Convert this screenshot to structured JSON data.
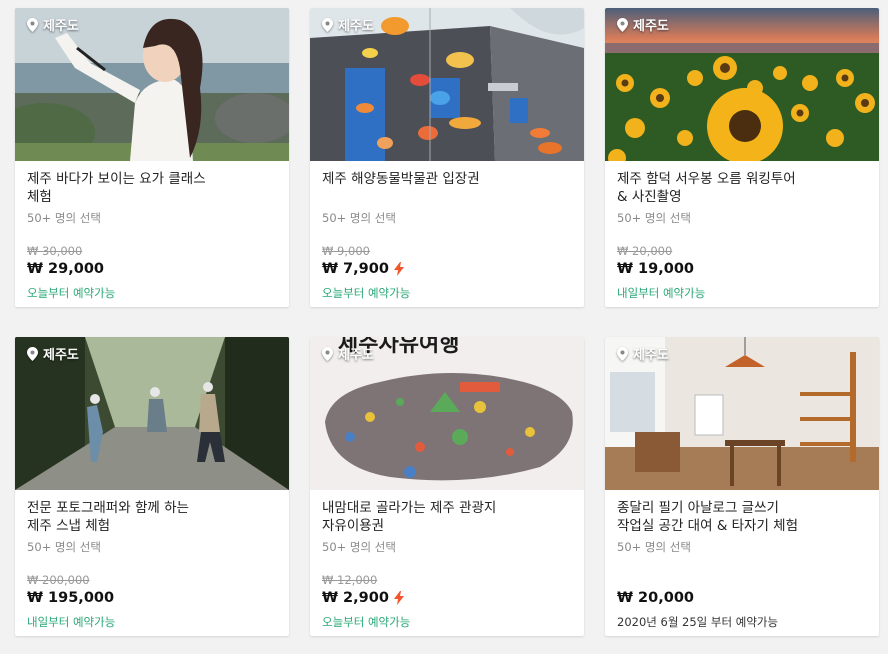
{
  "products": [
    {
      "location": "제주도",
      "title": "제주 바다가 보이는 요가 클래스\n체험",
      "picks": "50+ 명의 선택",
      "original_price": "₩ 30,000",
      "price": "₩ 29,000",
      "instant": false,
      "availability": "오늘부터 예약가능",
      "availability_color": "#2aa876"
    },
    {
      "location": "제주도",
      "title": "제주 해양동물박물관 입장권",
      "picks": "50+ 명의 선택",
      "original_price": "₩ 9,000",
      "price": "₩ 7,900",
      "instant": true,
      "availability": "오늘부터 예약가능",
      "availability_color": "#2aa876"
    },
    {
      "location": "제주도",
      "title": "제주 함덕 서우봉 오름 워킹투어\n& 사진촬영",
      "picks": "50+ 명의 선택",
      "original_price": "₩ 20,000",
      "price": "₩ 19,000",
      "instant": false,
      "availability": "내일부터 예약가능",
      "availability_color": "#2aa876"
    },
    {
      "location": "제주도",
      "title": "전문 포토그래퍼와 함께 하는\n제주 스냅 체험",
      "picks": "50+ 명의 선택",
      "original_price": "₩ 200,000",
      "price": "₩ 195,000",
      "instant": false,
      "availability": "내일부터 예약가능",
      "availability_color": "#2aa876"
    },
    {
      "location": "제주도",
      "title": "내맘대로 골라가는 제주 관광지\n자유이용권",
      "picks": "50+ 명의 선택",
      "original_price": "₩ 12,000",
      "price": "₩ 2,900",
      "instant": true,
      "availability": "오늘부터 예약가능",
      "availability_color": "#2aa876"
    },
    {
      "location": "제주도",
      "title": "종달리 필기 아날로그 글쓰기\n작업실 공간 대여 & 타자기 체험",
      "picks": "50+ 명의 선택",
      "original_price": "",
      "price": "₩ 20,000",
      "instant": false,
      "availability": "2020년 6월 25일 부터 예약가능",
      "availability_color": "#333333"
    }
  ],
  "map_art_text": "제주자유여행",
  "colors": {
    "accent_green": "#2aa876",
    "instant_bolt": "#f2552c"
  }
}
